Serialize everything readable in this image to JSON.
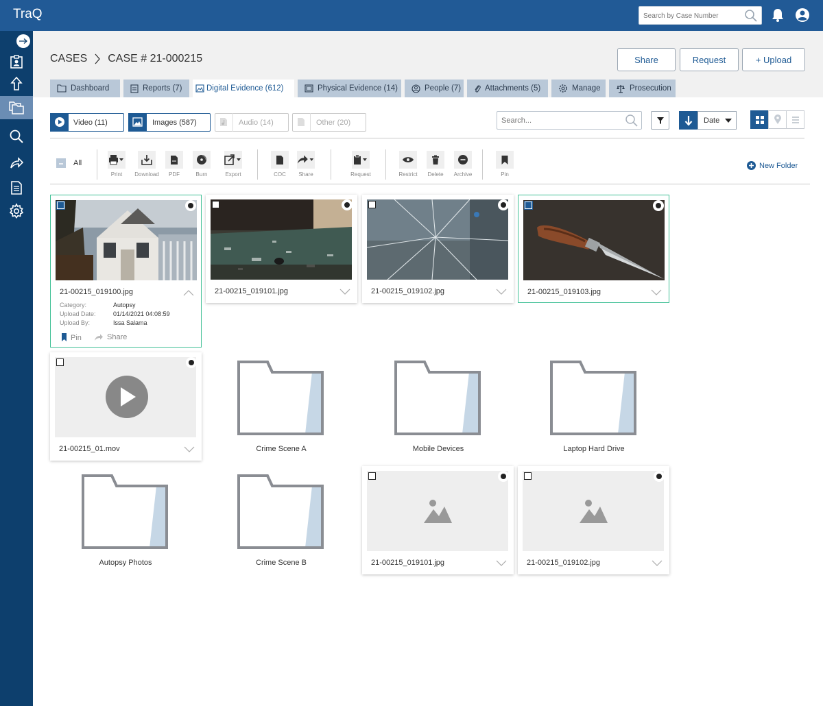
{
  "app": {
    "title": "TraQ"
  },
  "topbar": {
    "search_placeholder": "Search by Case Number"
  },
  "breadcrumb": {
    "root": "CASES",
    "current": "CASE # 21-000215"
  },
  "header_buttons": {
    "share": "Share",
    "request": "Request",
    "upload": "+ Upload"
  },
  "tabs": [
    {
      "label": "Dashboard",
      "icon": "folder-icon"
    },
    {
      "label": "Reports  (7)",
      "icon": "report-icon"
    },
    {
      "label": "Digital Evidence (612)",
      "icon": "image-icon"
    },
    {
      "label": "Physical Evidence (14)",
      "icon": "box-icon"
    },
    {
      "label": "People (7)",
      "icon": "person-icon"
    },
    {
      "label": "Attachments  (5)",
      "icon": "paperclip-icon"
    },
    {
      "label": "Manage",
      "icon": "gear-icon"
    },
    {
      "label": "Prosecution",
      "icon": "scales-icon"
    }
  ],
  "type_filters": [
    {
      "label": "Video (11)",
      "active": true
    },
    {
      "label": "Images (587)",
      "active": true
    },
    {
      "label": "Audio (14)",
      "active": false
    },
    {
      "label": "Other (20)",
      "active": false
    }
  ],
  "search": {
    "placeholder": "Search..."
  },
  "sort": {
    "value": "Date"
  },
  "toolbar": {
    "all_label": "All",
    "tools": [
      "Print",
      "Download",
      "PDF",
      "Burn",
      "Export",
      "COC",
      "Share",
      "Request",
      "Restrict",
      "Delete",
      "Archive",
      "Pin"
    ],
    "new_folder": "New Folder"
  },
  "files": [
    {
      "name": "21-00215_019100.jpg",
      "selected": true,
      "expanded": true,
      "details": {
        "category_label": "Category:",
        "category": "Autopsy",
        "date_label": "Upload Date:",
        "date": "01/14/2021 04:08:59",
        "by_label": "Upload By:",
        "by": "Issa Salama",
        "pin": "Pin",
        "share": "Share"
      }
    },
    {
      "name": "21-00215_019101.jpg",
      "selected": false
    },
    {
      "name": "21-00215_019102.jpg",
      "selected": false
    },
    {
      "name": "21-00215_019103.jpg",
      "selected": true
    },
    {
      "name": "21-00215_01.mov",
      "selected": false
    },
    {
      "name": "21-00215_019101.jpg",
      "selected": false
    },
    {
      "name": "21-00215_019102.jpg",
      "selected": false
    }
  ],
  "folders": [
    "Crime Scene A",
    "Mobile Devices",
    "Laptop Hard Drive",
    "Autopsy Photos",
    "Crime Scene B"
  ],
  "colors": {
    "topbar": "#215a96",
    "sidebar": "#0d3f6d",
    "accent": "#1e5a94",
    "tab": "#b9c8d8",
    "selected_border": "#3dbf94"
  }
}
